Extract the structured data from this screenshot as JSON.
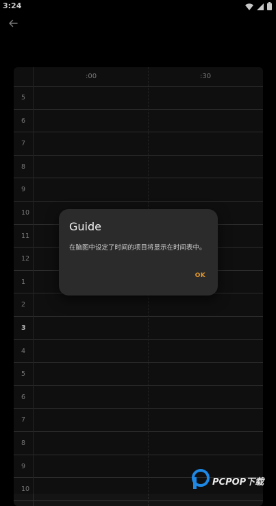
{
  "status_bar": {
    "time": "3:24",
    "icons": [
      "wifi-icon",
      "signal-icon",
      "battery-icon"
    ]
  },
  "app_bar": {
    "back_icon": "arrow-left-icon"
  },
  "timetable": {
    "columns": [
      ":00",
      ":30"
    ],
    "rows": [
      "5",
      "6",
      "7",
      "8",
      "9",
      "10",
      "11",
      "12",
      "1",
      "2",
      "3",
      "4",
      "5",
      "6",
      "7",
      "8",
      "9",
      "10"
    ],
    "current_row_index": 10
  },
  "dialog": {
    "title": "Guide",
    "message": "在脑图中设定了时间的项目将显示在时间表中。",
    "ok_label": "OK",
    "accent_color": "#e89a2c"
  },
  "watermark": {
    "text": "PCPOP下载"
  }
}
